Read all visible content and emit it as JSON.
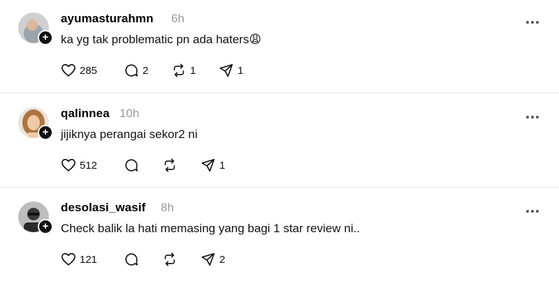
{
  "posts": [
    {
      "username": "ayumasturahmn",
      "time": "6h",
      "text": "ka yg tak problematic pn ada haters😩",
      "likes": "285",
      "replies": "2",
      "reposts": "1",
      "shares": "1"
    },
    {
      "username": "qalinnea",
      "time": "10h",
      "text": "jijiknya perangai sekor2 ni",
      "likes": "512",
      "replies": "",
      "reposts": "",
      "shares": "1"
    },
    {
      "username": "desolasi_wasif",
      "time": "8h",
      "text": "Check balik la hati memasing yang bagi 1 star review ni..",
      "likes": "121",
      "replies": "",
      "reposts": "",
      "shares": "2"
    }
  ],
  "icons": {
    "like": "heart-icon",
    "reply": "comment-icon",
    "repost": "repost-icon",
    "share": "share-icon",
    "more": "more-icon",
    "follow": "plus-icon"
  },
  "colors": {
    "text": "#000000",
    "muted": "#999999",
    "divider": "#e5e5e5"
  }
}
